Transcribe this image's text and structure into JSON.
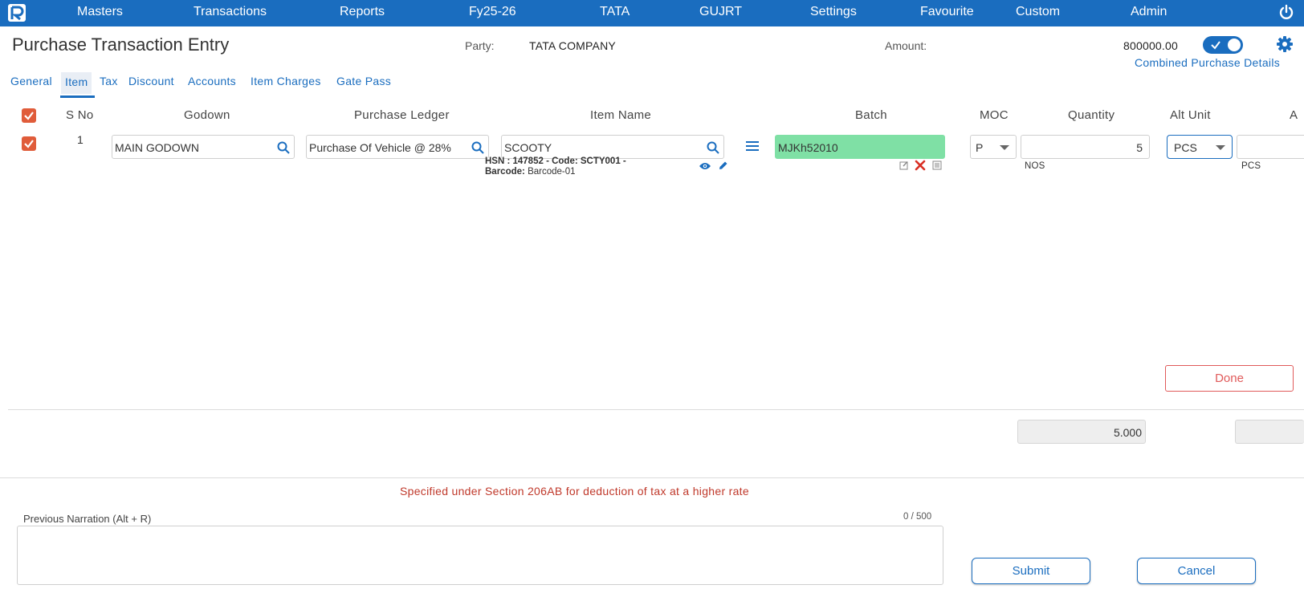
{
  "nav": {
    "items": [
      "Masters",
      "Transactions",
      "Reports",
      "Fy25-26",
      "TATA",
      "GUJRT",
      "Settings",
      "Favourite",
      "Custom",
      "Admin"
    ]
  },
  "header": {
    "title": "Purchase Transaction Entry",
    "party_label": "Party:",
    "party_value": "TATA COMPANY",
    "amount_label": "Amount:",
    "amount_value": "800000.00",
    "combined_toggle_on": true,
    "combined_link": "Combined Purchase Details"
  },
  "tabs": {
    "items": [
      "General",
      "Item",
      "Tax",
      "Discount",
      "Accounts",
      "Item Charges",
      "Gate Pass"
    ],
    "active": "Item"
  },
  "table": {
    "columns": [
      "S No",
      "Godown",
      "Purchase Ledger",
      "Item Name",
      "Batch",
      "MOC",
      "Quantity",
      "Alt Unit",
      "A"
    ],
    "header_checked": true,
    "rows": [
      {
        "checked": true,
        "sno": "1",
        "godown": "MAIN GODOWN",
        "purchase_ledger": "Purchase Of Vehicle @ 28%",
        "item_name": "SCOOTY",
        "item_meta_line1": "HSN : 147852 - Code: SCTY001 -",
        "item_meta_barcode_label": "Barcode:",
        "item_meta_barcode_value": "Barcode-01",
        "batch": "MJKh52010",
        "moc": "P",
        "quantity": "5",
        "quantity_unit": "NOS",
        "alt_unit": "PCS",
        "alt_qty": "",
        "alt_qty_unit": "PCS"
      }
    ]
  },
  "actions": {
    "done": "Done",
    "submit": "Submit",
    "cancel": "Cancel"
  },
  "totals": {
    "quantity_total": "5.000",
    "alt_total": ""
  },
  "warning": "Specified under Section 206AB for deduction of tax at a higher rate",
  "narration": {
    "label": "Previous Narration (Alt + R)",
    "counter": "0 / 500",
    "value": ""
  },
  "colors": {
    "primary": "#1a6dbf",
    "checkbox": "#e05c3a",
    "batch_highlight": "#7fe0a5",
    "warning": "#c0392b",
    "done_border": "#e05a5a"
  },
  "icons": [
    "logo-icon",
    "power-icon",
    "gear-icon",
    "search-icon",
    "menu-icon",
    "eye-icon",
    "pencil-icon",
    "edit-icon",
    "delete-icon",
    "list-icon",
    "chevron-down-icon",
    "check-icon"
  ]
}
